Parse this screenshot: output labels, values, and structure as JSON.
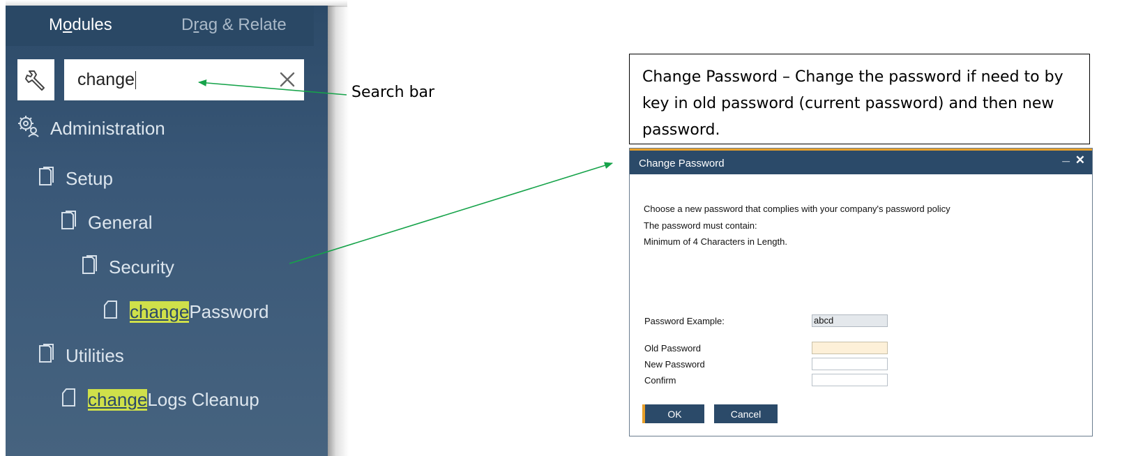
{
  "panel": {
    "tabs": [
      {
        "label_pre": "M",
        "label_u": "o",
        "label_post": "dules"
      },
      {
        "label_pre": "D",
        "label_u": "r",
        "label_post": "ag & Relate"
      }
    ],
    "search": {
      "value": "change"
    },
    "tree": [
      {
        "label": "Administration",
        "icon": "admin-gear-icon"
      },
      {
        "label": "Setup",
        "icon": "folder-icon"
      },
      {
        "label": "General",
        "icon": "folder-icon"
      },
      {
        "label": "Security",
        "icon": "folder-icon"
      },
      {
        "label_hl": "change",
        "label": " Password",
        "icon": "document-icon"
      },
      {
        "label": "Utilities",
        "icon": "folder-icon"
      },
      {
        "label_hl": "change",
        "label": " Logs Cleanup",
        "icon": "document-icon"
      }
    ]
  },
  "annotations": {
    "search_bar": "Search bar",
    "description": "Change Password – Change the password if need to by key in old password (current password) and then new password."
  },
  "dialog": {
    "title": "Change Password",
    "lines": [
      "Choose a new password that complies with your company's password policy",
      "The password must contain:",
      "Minimum of 4 Characters in Length."
    ],
    "example_label": "Password Example:",
    "example_value": "abcd",
    "old_label": "Old Password",
    "new_label": "New Password",
    "confirm_label": "Confirm",
    "ok": "OK",
    "cancel": "Cancel",
    "minimize": "_",
    "close": "✕"
  },
  "colors": {
    "panel": "#3a5878",
    "highlight": "#cfe04a",
    "dialog_title": "#2b4a69",
    "accent": "#e8a02a",
    "arrow": "#16a34a"
  }
}
